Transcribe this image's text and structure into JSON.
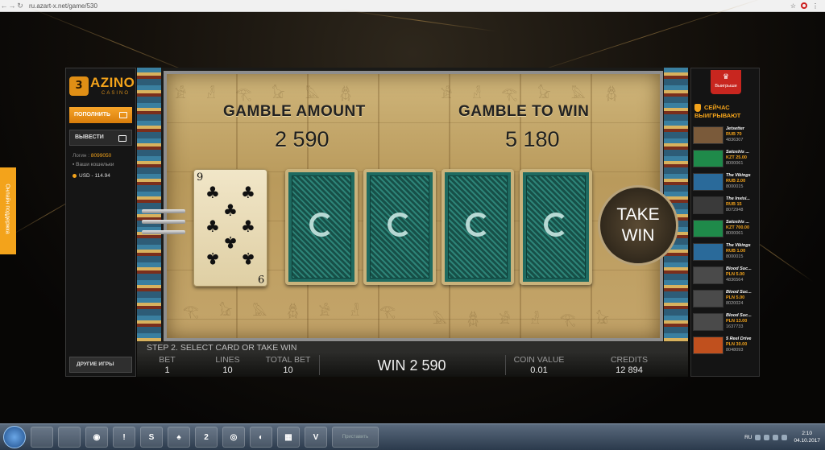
{
  "browser": {
    "url": "ru.azart-x.net/game/530"
  },
  "left_panel": {
    "logo_badge": "3",
    "logo_main": "AZINO",
    "logo_sub": "CASINO",
    "deposit_label": "ПОПОЛНИТЬ",
    "withdraw_label": "ВЫВЕСТИ",
    "login_label": "Логин :",
    "login_value": "8099050",
    "wallets_label": "Ваши кошельки",
    "balance": "USD - 114.94",
    "other_games_label": "ДРУГИЕ ИГРЫ"
  },
  "support_tab": {
    "label": "Онлайн поддержка"
  },
  "game": {
    "gamble_amount_label": "GAMBLE AMOUNT",
    "gamble_amount_value": "2 590",
    "gamble_to_win_label": "GAMBLE TO WIN",
    "gamble_to_win_value": "5 180",
    "revealed_card": {
      "rank": "9",
      "suit": "clubs"
    },
    "face_down_cards": 4,
    "take_win_label": "TAKE\nWIN",
    "step_text": "STEP 2. SELECT CARD OR TAKE WIN",
    "bet_label": "BET",
    "bet_value": "1",
    "lines_label": "LINES",
    "lines_value": "10",
    "total_bet_label": "TOTAL BET",
    "total_bet_value": "10",
    "win_text": "WIN 2 590",
    "coin_value_label": "COIN VALUE",
    "coin_value_value": "0.01",
    "credits_label": "CREDITS",
    "credits_value": "12 894"
  },
  "right_panel": {
    "winners_badge": "Выигрыши",
    "now_winning_line1": "СЕЙЧАС",
    "now_winning_line2": "ВЫИГРЫВАЮТ",
    "wins": [
      {
        "game": "Jetsetter",
        "amount": "RUB 70",
        "user": "4836307",
        "color": "#7a5a3a"
      },
      {
        "game": "Satoshis ...",
        "amount": "KZT 25.00",
        "user": "8000061",
        "color": "#1f8a4a"
      },
      {
        "game": "The Vikings",
        "amount": "RUB 2.00",
        "user": "8000015",
        "color": "#2a6a9a"
      },
      {
        "game": "The Invisi...",
        "amount": "RUB 15",
        "user": "8072948",
        "color": "#3a3a3a"
      },
      {
        "game": "Satoshis ...",
        "amount": "KZT 700.00",
        "user": "8000061",
        "color": "#1f8a4a"
      },
      {
        "game": "The Vikings",
        "amount": "RUB 1.00",
        "user": "8000015",
        "color": "#2a6a9a"
      },
      {
        "game": "Blood Suc...",
        "amount": "PLN 5.00",
        "user": "4836564",
        "color": "#4a4a4a"
      },
      {
        "game": "Blood Suc...",
        "amount": "PLN 5.00",
        "user": "8020024",
        "color": "#4a4a4a"
      },
      {
        "game": "Blood Suc...",
        "amount": "PLN 13.00",
        "user": "1637733",
        "color": "#4a4a4a"
      },
      {
        "game": "5 Reel Drive",
        "amount": "PLN 30.00",
        "user": "8048093",
        "color": "#c0501e"
      }
    ]
  },
  "taskbar": {
    "search_label": "Приставить",
    "lang": "RU",
    "time": "2:10",
    "date": "04.10.2017"
  }
}
